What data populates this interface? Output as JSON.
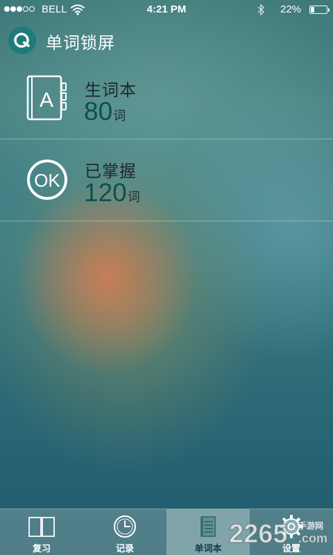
{
  "status_bar": {
    "carrier": "BELL",
    "time": "4:21 PM",
    "battery_percent": "22%",
    "battery_level": 0.22,
    "signal_bars_filled": 3,
    "signal_bars_total": 5
  },
  "header": {
    "title": "单词锁屏",
    "logo_icon": "app-logo-icon"
  },
  "list": {
    "items": [
      {
        "label": "生词本",
        "count": "80",
        "unit": "词",
        "icon": "book-a-icon"
      },
      {
        "label": "已掌握",
        "count": "120",
        "unit": "词",
        "icon": "ok-circle-icon"
      }
    ]
  },
  "tab_bar": {
    "tabs": [
      {
        "label": "复习",
        "icon": "open-book-icon",
        "active": false
      },
      {
        "label": "记录",
        "icon": "clock-icon",
        "active": false
      },
      {
        "label": "单词本",
        "icon": "notebook-icon",
        "active": true
      },
      {
        "label": "设置",
        "icon": "gear-icon",
        "active": false
      }
    ]
  },
  "watermark": {
    "text": "2265",
    "suffix": "手游网",
    "domain": ".com"
  },
  "colors": {
    "accent": "#0e4f54",
    "logo_bg": "#1d7b7b"
  }
}
